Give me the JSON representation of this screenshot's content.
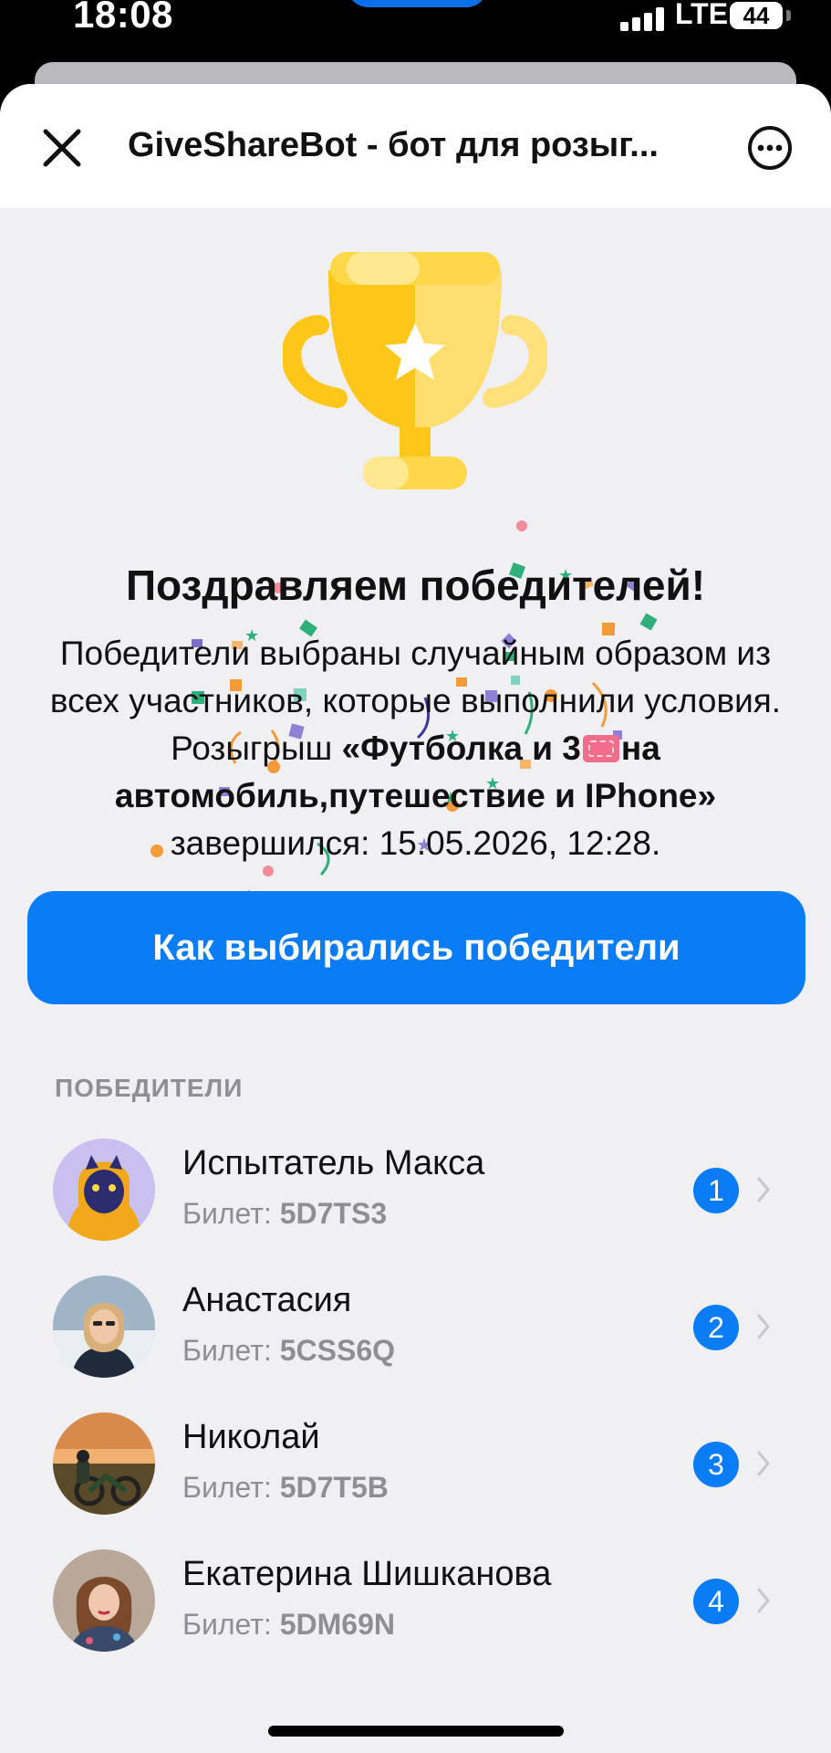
{
  "status_bar": {
    "time": "18:08",
    "network": "LTE",
    "battery": "44"
  },
  "header": {
    "title": "GiveShareBot - бот для розыг..."
  },
  "congrats": {
    "title": "Поздравляем победителей!",
    "desc_start": "Победители выбраны случайным образом из всех участников, которые выполнили условия. Розыгрыш ",
    "giveaway_name_part1": "«Футболка и 3",
    "giveaway_name_part2": "на автомобиль,путешествие и IPhone»",
    "desc_end": " завершился: 15.05.2026, 12:28."
  },
  "how_button": {
    "label": "Как выбирались победители"
  },
  "winners_section": {
    "label": "ПОБЕДИТЕЛИ",
    "ticket_prefix": "Билет:",
    "items": [
      {
        "name": "Испытатель Макса",
        "ticket": "5D7TS3",
        "place": "1"
      },
      {
        "name": "Анастасия",
        "ticket": "5CSS6Q",
        "place": "2"
      },
      {
        "name": "Николай",
        "ticket": "5D7T5B",
        "place": "3"
      },
      {
        "name": "Екатерина Шишканова",
        "ticket": "5DM69N",
        "place": "4"
      }
    ]
  },
  "colors": {
    "accent": "#0a7cf6",
    "background": "#efeff4",
    "trophy": "#ffc61a"
  }
}
